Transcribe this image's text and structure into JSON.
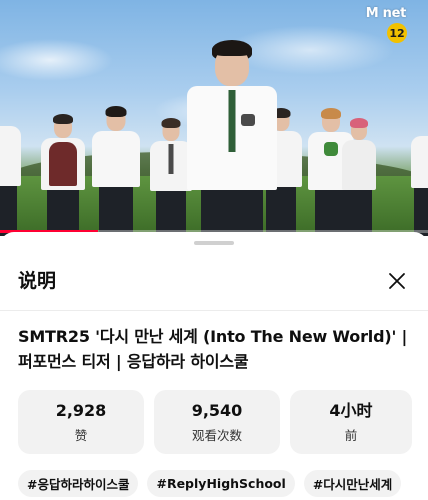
{
  "overlay": {
    "channel_logo": "M net",
    "age_rating": "12"
  },
  "player": {
    "progress_percent": 23,
    "progress_color": "#ff0033"
  },
  "panel": {
    "title": "说明",
    "close_icon": "close-icon"
  },
  "video": {
    "title": "SMTR25 '다시 만난 세계 (Into The New World)' | 퍼포먼스 티저 | 응답하라 하이스쿨"
  },
  "stats": [
    {
      "value": "2,928",
      "label": "赞"
    },
    {
      "value": "9,540",
      "label": "观看次数"
    },
    {
      "value": "4小时",
      "label": "前"
    }
  ],
  "hashtags": [
    "#응답하라하이스쿨",
    "#ReplyHighSchool",
    "#다시만난세계"
  ]
}
